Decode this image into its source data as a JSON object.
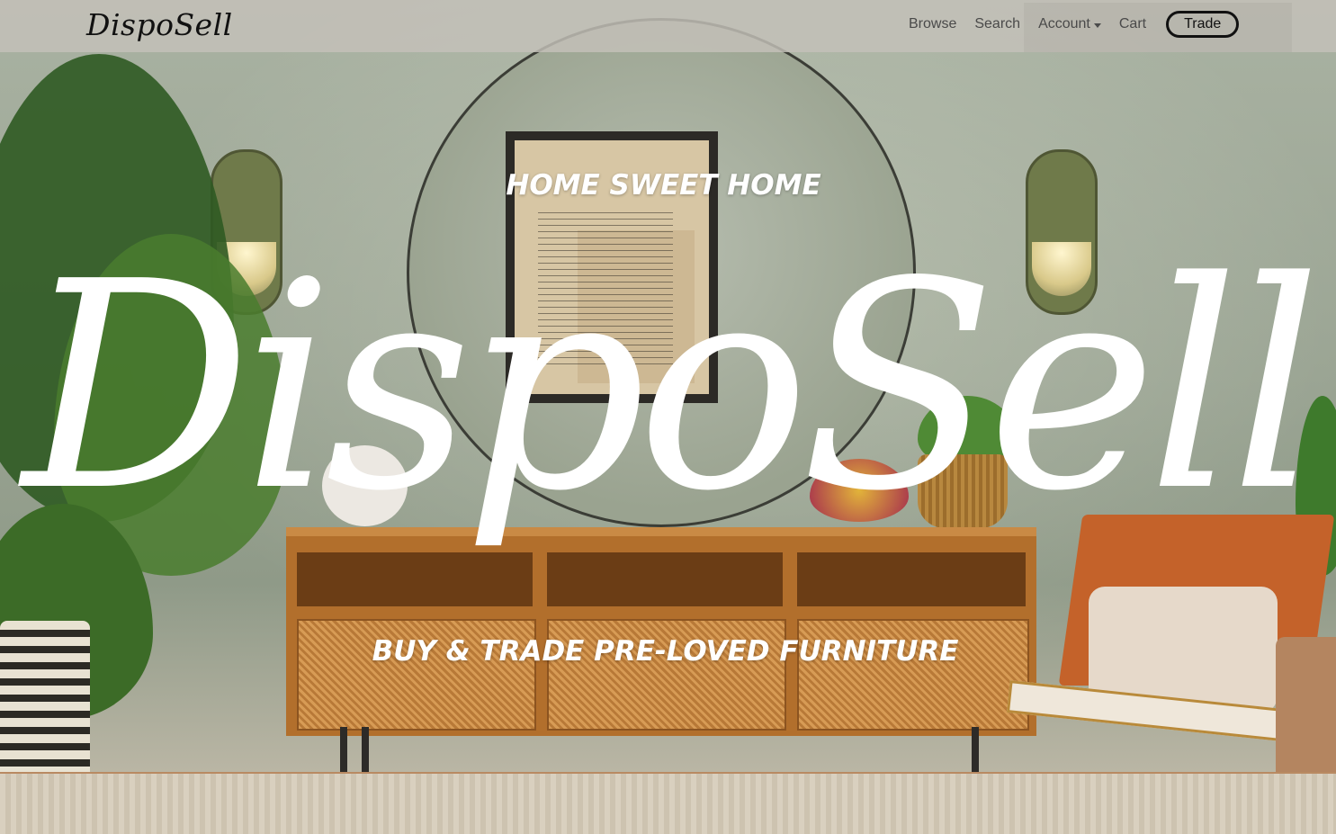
{
  "brand": {
    "logo_text": "DispoSell"
  },
  "nav": {
    "links": [
      "Browse",
      "Search",
      "Account",
      "Cart"
    ],
    "cta_label": "Trade"
  },
  "hero": {
    "kicker": "HOME SWEET HOME",
    "big_logo": "DispoSell",
    "subtitle": "BUY & TRADE PRE-LOVED FURNITURE"
  },
  "colors": {
    "nav_bg": "#c4c1b9",
    "overlay_text": "#ffffff",
    "wall": "#9aa493",
    "console_wood": "#b26f2c"
  },
  "icons": {
    "account_dropdown": "caret-down-icon"
  }
}
